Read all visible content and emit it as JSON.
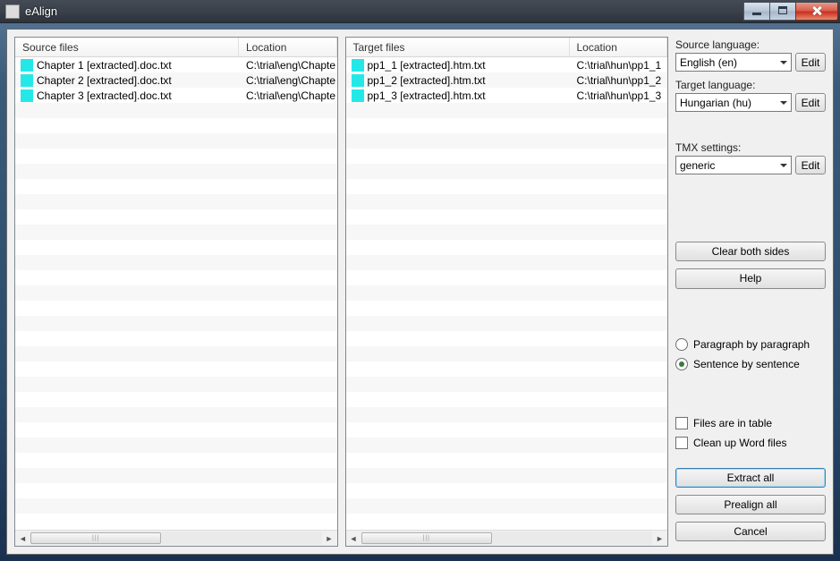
{
  "window": {
    "title": "eAlign"
  },
  "source": {
    "headers": [
      "Source files",
      "Location"
    ],
    "rows": [
      {
        "name": "Chapter 1 [extracted].doc.txt",
        "path": "C:\\trial\\eng\\Chapte"
      },
      {
        "name": "Chapter 2 [extracted].doc.txt",
        "path": "C:\\trial\\eng\\Chapte"
      },
      {
        "name": "Chapter 3 [extracted].doc.txt",
        "path": "C:\\trial\\eng\\Chapte"
      }
    ]
  },
  "target": {
    "headers": [
      "Target files",
      "Location"
    ],
    "rows": [
      {
        "name": "pp1_1 [extracted].htm.txt",
        "path": "C:\\trial\\hun\\pp1_1"
      },
      {
        "name": "pp1_2 [extracted].htm.txt",
        "path": "C:\\trial\\hun\\pp1_2"
      },
      {
        "name": "pp1_3 [extracted].htm.txt",
        "path": "C:\\trial\\hun\\pp1_3"
      }
    ]
  },
  "side": {
    "source_lang_label": "Source language:",
    "source_lang_value": "English (en)",
    "target_lang_label": "Target language:",
    "target_lang_value": "Hungarian (hu)",
    "tmx_label": "TMX settings:",
    "tmx_value": "generic",
    "edit_label": "Edit",
    "clear_label": "Clear both sides",
    "help_label": "Help",
    "radio_paragraph": "Paragraph by paragraph",
    "radio_sentence": "Sentence by sentence",
    "check_table": "Files are in table",
    "check_clean": "Clean up Word files",
    "extract_label": "Extract all",
    "prealign_label": "Prealign all",
    "cancel_label": "Cancel"
  }
}
